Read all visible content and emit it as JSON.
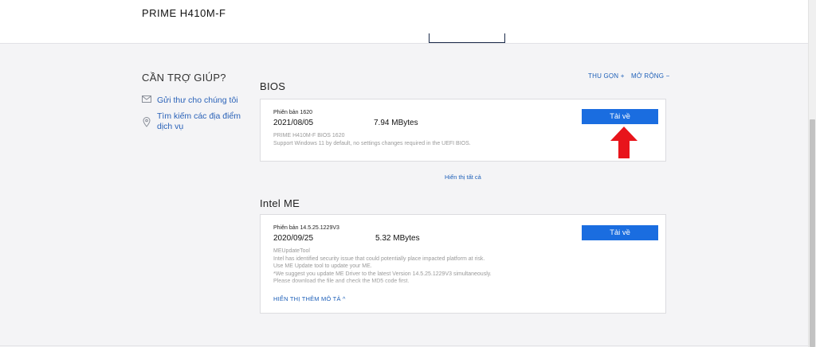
{
  "header": {
    "product_title": "PRIME H410M-F"
  },
  "help": {
    "title": "CẦN TRỢ GIÚP?",
    "email_link": "Gửi thư cho chúng tôi",
    "service_line1": "Tìm kiếm các địa điểm",
    "service_line2": "dịch vụ"
  },
  "controls": {
    "collapse": "THU GỌN +",
    "expand": "MỞ RỘNG −"
  },
  "bios": {
    "section_title": "BIOS",
    "version_label": "Phiên bản 1620",
    "date": "2021/08/05",
    "size": "7.94 MBytes",
    "desc_line1": "PRIME H410M-F BIOS 1620",
    "desc_line2": "Support Windows 11 by default, no settings changes required in the UEFI BIOS.",
    "download_label": "Tải về",
    "show_all": "Hiển thị tất cả"
  },
  "intel_me": {
    "section_title": "Intel ME",
    "version_label": "Phiên bản 14.5.25.1229V3",
    "date": "2020/09/25",
    "size": "5.32 MBytes",
    "desc_lines": [
      "MEUpdateTool",
      "Intel has identified security issue that could potentially place impacted platform at risk.",
      "Use ME Update tool to update your ME.",
      "*We suggest you update ME Driver to the latest Version 14.5.25.1229V3 simultaneously.",
      "Please download the file and check the MD5 code first."
    ],
    "download_label": "Tải về",
    "more_desc": "HIỂN THỊ THÊM MÔ TẢ ^"
  },
  "colors": {
    "accent": "#1a6de0",
    "link": "#1d5fb8",
    "arrow": "#e8141b"
  }
}
